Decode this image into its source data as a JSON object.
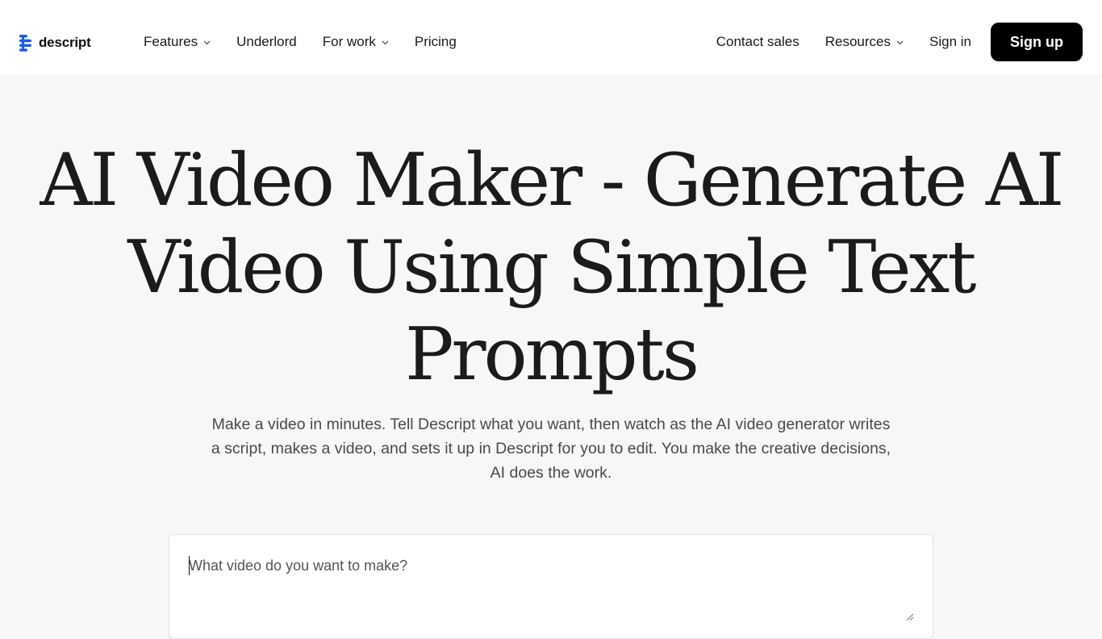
{
  "brand": {
    "name": "descript",
    "accent_color": "#1a5cf0"
  },
  "nav": {
    "left": [
      {
        "label": "Features",
        "has_dropdown": true
      },
      {
        "label": "Underlord",
        "has_dropdown": false
      },
      {
        "label": "For work",
        "has_dropdown": true
      },
      {
        "label": "Pricing",
        "has_dropdown": false
      }
    ],
    "right": [
      {
        "label": "Contact sales",
        "has_dropdown": false
      },
      {
        "label": "Resources",
        "has_dropdown": true
      },
      {
        "label": "Sign in",
        "has_dropdown": false
      }
    ],
    "signup_label": "Sign up"
  },
  "hero": {
    "title": "AI Video Maker - Generate AI Video Using Simple Text Prompts",
    "subtitle": "Make a video in minutes. Tell Descript what you want, then watch as the AI video generator writes a script, makes a video, and sets it up in Descript for you to edit. You make the creative decisions, AI does the work."
  },
  "prompt": {
    "placeholder": "What video do you want to make?",
    "value": ""
  },
  "icons": {
    "logo": "descript-logo-icon",
    "dropdown": "chevron-down-icon",
    "resize": "resize-handle-icon"
  }
}
